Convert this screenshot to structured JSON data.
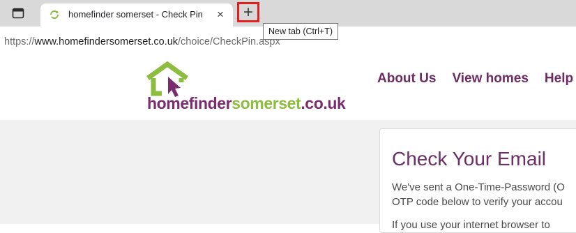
{
  "browser": {
    "tab": {
      "title": "homefinder somerset - Check Pin",
      "close_icon": "×"
    },
    "new_tab": {
      "symbol": "+",
      "tooltip": "New tab (Ctrl+T)"
    },
    "url": {
      "scheme": "https://",
      "host": "www.homefindersomerset.co.uk",
      "path": "/choice/CheckPin.aspx"
    }
  },
  "site": {
    "logo": {
      "part1": "homefinder",
      "part2": "somerset",
      "part3": ".co.uk"
    },
    "nav": [
      "About Us",
      "View homes",
      "Help"
    ]
  },
  "card": {
    "title": "Check Your Email",
    "line1": "We've sent a One-Time-Password (O",
    "line2": "OTP code below to verify your accou",
    "line3": "If you use your internet browser to"
  },
  "colors": {
    "brand_purple": "#7b2c6e",
    "brand_green": "#8cbd3f",
    "highlight_red": "#e0201f"
  }
}
